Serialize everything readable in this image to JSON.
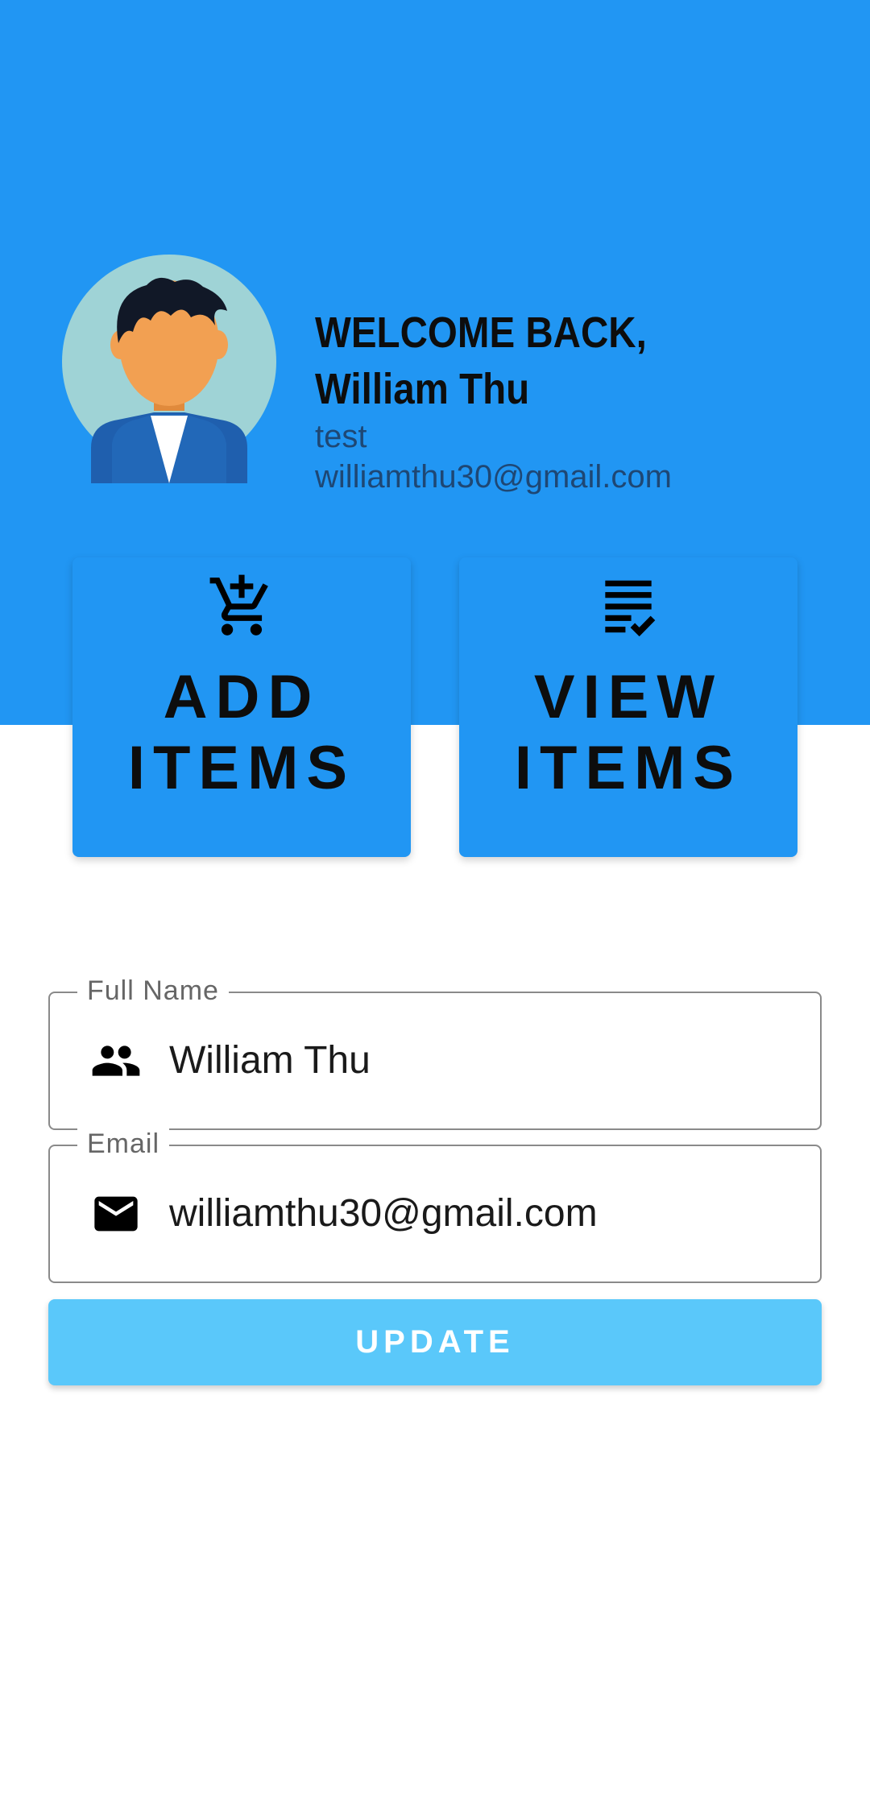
{
  "header": {
    "welcome": "WELCOME BACK, William Thu",
    "role": "test",
    "email": "williamthu30@gmail.com",
    "background_color": "#2196f3"
  },
  "actions": [
    {
      "label": "ADD\nITEMS",
      "icon": "add-shopping-cart-icon"
    },
    {
      "label": "VIEW\nITEMS",
      "icon": "checklist-icon"
    }
  ],
  "form": {
    "full_name": {
      "label": "Full Name",
      "value": "William Thu",
      "icon": "people-icon"
    },
    "email": {
      "label": "Email",
      "value": "williamthu30@gmail.com",
      "icon": "mail-icon"
    },
    "update_label": "UPDATE",
    "update_color": "#5ac8fa"
  }
}
